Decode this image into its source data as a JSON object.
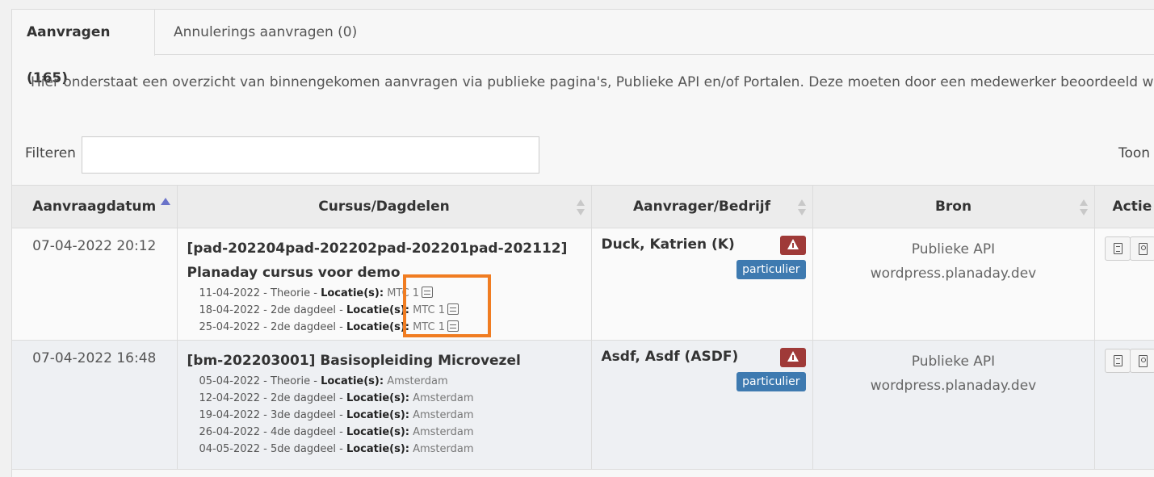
{
  "tabs": [
    {
      "label": "Aanvragen (165)"
    },
    {
      "label": "Annulerings aanvragen (0)"
    }
  ],
  "intro_text": "Hier onderstaat een overzicht van binnengekomen aanvragen via publieke pagina's, Publieke API en/of Portalen. Deze moeten door een medewerker beoordeeld word",
  "filter": {
    "label": "Filteren",
    "value": ""
  },
  "toon_label": "Toon",
  "columns": {
    "date": "Aanvraagdatum",
    "course": "Cursus/Dagdelen",
    "requester": "Aanvrager/Bedrijf",
    "source": "Bron",
    "actions": "Actie"
  },
  "rows": [
    {
      "date": "07-04-2022 20:12",
      "course_title_1": "[pad-202204pad-202202pad-202201pad-202112]",
      "course_title_2": "Planaday cursus voor demo",
      "sessions": [
        {
          "text": "11-04-2022 - Theorie - ",
          "loc_label": "Locatie(s):",
          "loc": " MTC 1"
        },
        {
          "text": "18-04-2022 - 2de dagdeel - ",
          "loc_label": "Locatie(s):",
          "loc": " MTC 1"
        },
        {
          "text": "25-04-2022 - 2de dagdeel - ",
          "loc_label": "Locatie(s):",
          "loc": " MTC 1"
        }
      ],
      "requester": "Duck, Katrien (K)",
      "type_badge": "particulier",
      "source_1": "Publieke API",
      "source_2": "wordpress.planaday.dev"
    },
    {
      "date": "07-04-2022 16:48",
      "course_title_1": "[bm-202203001] Basisopleiding Microvezel",
      "sessions": [
        {
          "text": "05-04-2022 - Theorie - ",
          "loc_label": "Locatie(s):",
          "loc": " Amsterdam"
        },
        {
          "text": "12-04-2022 - 2de dagdeel - ",
          "loc_label": "Locatie(s):",
          "loc": " Amsterdam"
        },
        {
          "text": "19-04-2022 - 3de dagdeel - ",
          "loc_label": "Locatie(s):",
          "loc": " Amsterdam"
        },
        {
          "text": "26-04-2022 - 4de dagdeel - ",
          "loc_label": "Locatie(s):",
          "loc": " Amsterdam"
        },
        {
          "text": "04-05-2022 - 5de dagdeel - ",
          "loc_label": "Locatie(s):",
          "loc": " Amsterdam"
        }
      ],
      "requester": "Asdf, Asdf (ASDF)",
      "type_badge": "particulier",
      "source_1": "Publieke API",
      "source_2": "wordpress.planaday.dev"
    }
  ],
  "colors": {
    "highlight": "#f07c21",
    "warning_badge": "#9f3a38",
    "type_badge": "#3e7ab0",
    "sort_active": "#6a73c9"
  }
}
